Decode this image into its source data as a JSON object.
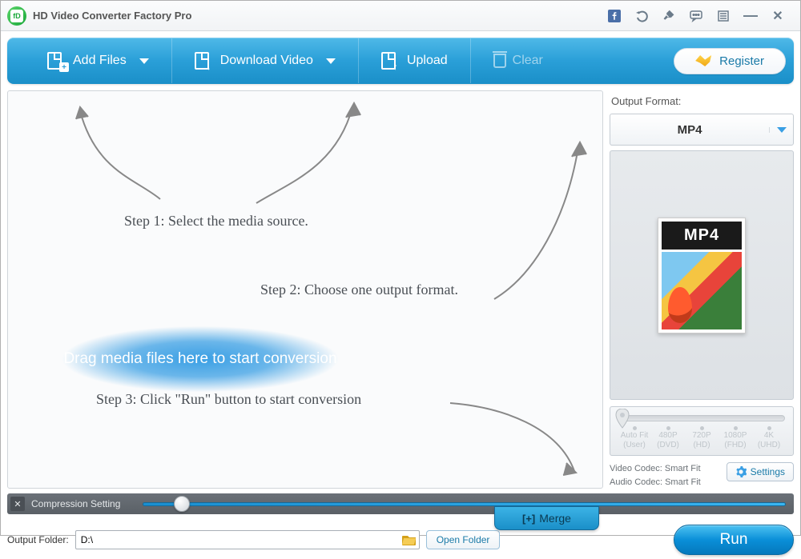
{
  "app": {
    "title": "HD Video Converter Factory Pro"
  },
  "toolbar": {
    "add_files": "Add Files",
    "download_video": "Download Video",
    "upload": "Upload",
    "clear": "Clear",
    "register": "Register"
  },
  "canvas": {
    "step1": "Step 1: Select the media source.",
    "step2": "Step 2: Choose one output format.",
    "step3": "Step 3: Click \"Run\" button to start conversion",
    "drop_hint": "Drag media files here to start conversion"
  },
  "output": {
    "label": "Output Format:",
    "selected": "MP4",
    "thumb_label": "MP4"
  },
  "resolution": {
    "ticks": [
      {
        "line1": "Auto Fit",
        "line2": "(User)"
      },
      {
        "line1": "480P",
        "line2": "(DVD)"
      },
      {
        "line1": "720P",
        "line2": "(HD)"
      },
      {
        "line1": "1080P",
        "line2": "(FHD)"
      },
      {
        "line1": "4K",
        "line2": "(UHD)"
      }
    ]
  },
  "codec": {
    "video": "Video Codec: Smart Fit",
    "audio": "Audio Codec: Smart Fit",
    "settings": "Settings"
  },
  "compression": {
    "label": "Compression Setting"
  },
  "footer": {
    "output_folder_label": "Output Folder:",
    "output_folder_value": "D:\\",
    "open_folder": "Open Folder",
    "merge": "Merge",
    "run": "Run"
  }
}
